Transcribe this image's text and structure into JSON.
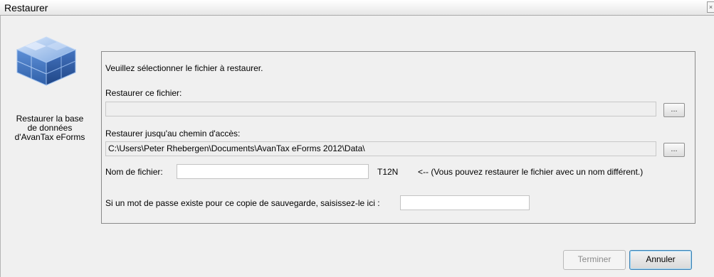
{
  "window": {
    "title": "Restaurer",
    "system_button": "×"
  },
  "sidebar": {
    "icon": "database-cubes-icon",
    "label": "Restaurer la base de données d'AvanTax eForms"
  },
  "form": {
    "intro": "Veuillez sélectionner le fichier à restaurer.",
    "restore_file_label": "Restaurer ce fichier:",
    "restore_file_value": "",
    "restore_path_label": "Restaurer jusqu'au chemin d'accès:",
    "restore_path_value": "C:\\Users\\Peter Rhebergen\\Documents\\AvanTax eForms 2012\\Data\\",
    "browse_label": "...",
    "filename_label": "Nom de fichier:",
    "filename_value": "",
    "extension": "T12N",
    "filename_hint": "<-- (Vous pouvez restaurer le fichier avec un nom différent.)",
    "password_label": "Si un mot de passe existe pour ce copie de sauvegarde, saisissez-le ici :",
    "password_value": ""
  },
  "buttons": {
    "finish": "Terminer",
    "cancel": "Annuler"
  }
}
